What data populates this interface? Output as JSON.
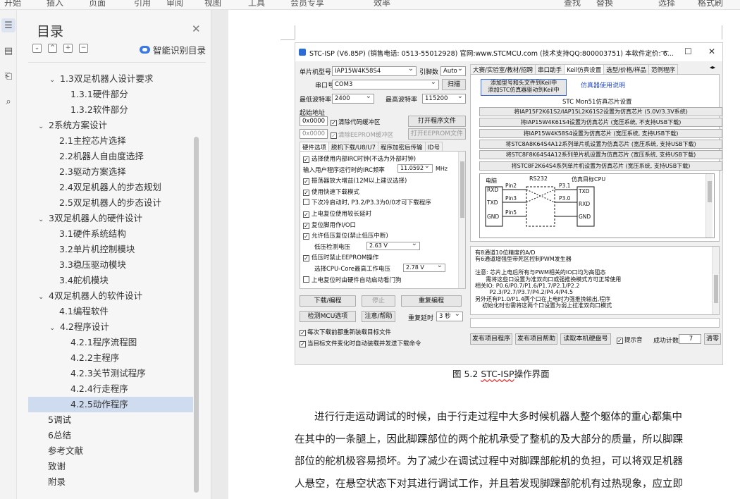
{
  "topstrip": [
    "开始",
    "插入",
    "页面",
    "引用",
    "审阅",
    "视图",
    "工具",
    "会员专享",
    "效率",
    "查找",
    "替换",
    "选择",
    "格式刷"
  ],
  "toc": {
    "title": "目录",
    "ai_label": "智能识别目录",
    "tools": [
      "⌄",
      "^",
      "+",
      "−"
    ],
    "items": [
      {
        "label": "1.3双足机器人设计要求",
        "chevron": "⌄"
      },
      {
        "label": "1.3.1硬件部分",
        "chevron": ""
      },
      {
        "label": "1.3.2软件部分",
        "chevron": ""
      },
      {
        "label": "2系统方案设计",
        "chevron": "⌄"
      },
      {
        "label": "2.1主控芯片选择",
        "chevron": ""
      },
      {
        "label": "2.2机器人自由度选择",
        "chevron": ""
      },
      {
        "label": "2.3驱动方案选择",
        "chevron": ""
      },
      {
        "label": "2.4双足机器人的步态规划",
        "chevron": ""
      },
      {
        "label": "2.5双足机器人的步态设计",
        "chevron": ""
      },
      {
        "label": "3双足机器人的硬件设计",
        "chevron": "⌄"
      },
      {
        "label": "3.1硬件系统结构",
        "chevron": ""
      },
      {
        "label": "3.2单片机控制模块",
        "chevron": ""
      },
      {
        "label": "3.3稳压驱动模块",
        "chevron": ""
      },
      {
        "label": "3.4舵机模块",
        "chevron": ""
      },
      {
        "label": "4双足机器人的软件设计",
        "chevron": "⌄"
      },
      {
        "label": "4.1编程软件",
        "chevron": ""
      },
      {
        "label": "4.2程序设计",
        "chevron": "⌄"
      },
      {
        "label": "4.2.1程序流程图",
        "chevron": ""
      },
      {
        "label": "4.2.2主程序",
        "chevron": ""
      },
      {
        "label": "4.2.3关节测试程序",
        "chevron": ""
      },
      {
        "label": "4.2.4行走程序",
        "chevron": ""
      },
      {
        "label": "4.2.5动作程序",
        "chevron": ""
      },
      {
        "label": "5调试",
        "chevron": ""
      },
      {
        "label": "6总结",
        "chevron": ""
      },
      {
        "label": "参考文献",
        "chevron": ""
      },
      {
        "label": "致谢",
        "chevron": ""
      },
      {
        "label": "附录",
        "chevron": ""
      }
    ]
  },
  "stc": {
    "title": "STC-ISP (V6.85P) (销售电话: 0513-55012928) 官网:www.STCMCU.com (技术支持QQ:800003751) 本软件定价: 6...",
    "mcu_label": "单片机型号",
    "mcu_value": "IAP15W4K58S4",
    "pins_label": "引脚数",
    "pins_value": "Auto",
    "port_label": "串口号",
    "port_value": "COM3",
    "scan": "扫描",
    "min_baud_label": "最低波特率",
    "min_baud": "2400",
    "max_baud_label": "最高波特率",
    "max_baud": "115200",
    "start_addr_label": "起始地址",
    "addr1": "0x0000",
    "clear_code": "清除代码缓冲区",
    "open_prog": "打开程序文件",
    "addr2": "0x0000",
    "clear_eeprom": "清除EEPROM缓冲区",
    "open_eeprom": "打开EEPROM文件",
    "left_tabs": [
      "硬件选项",
      "脱机下载/U8/U7",
      "程序加密后传输",
      "ID号"
    ],
    "options": [
      {
        "label": "选择使用内部IRC时钟(不选为外部时钟)",
        "checked": true
      },
      {
        "label": "输入用户程序运行时的IRC频率",
        "checked": null
      },
      {
        "label": "振荡器放大增益(12M以上建议选择)",
        "checked": true
      },
      {
        "label": "使用快速下载模式",
        "checked": true
      },
      {
        "label": "下次冷启动时, P3.2/P3.3为0/0才可下载程序",
        "checked": false
      },
      {
        "label": "上电复位使用较长延时",
        "checked": true
      },
      {
        "label": "复位脚用作I/O口",
        "checked": true
      },
      {
        "label": "允许低压复位(禁止低压中断)",
        "checked": true
      },
      {
        "label": "低压检测电压",
        "checked": null
      },
      {
        "label": "低压时禁止EEPROM操作",
        "checked": true
      },
      {
        "label": "选择CPU-Core最高工作电压",
        "checked": null
      },
      {
        "label": "上电复位时由硬件自动启动看门狗",
        "checked": false
      }
    ],
    "irc_freq": "11.0592",
    "irc_unit": "MHz",
    "low_volt": "2.63 V",
    "cpu_volt": "2.78 V",
    "btn_download": "下载/编程",
    "btn_stop": "停止",
    "btn_reprog": "重复编程",
    "btn_detect": "检测MCU选项",
    "btn_help": "注意/帮助",
    "repeat_delay_label": "重复延时",
    "repeat_delay": "3 秒",
    "chk_reload": "每次下载前都重新装载目标文件",
    "chk_autosend": "当目标文件变化时自动装载并发送下载命令",
    "right_tabs": [
      "大赛/实验室/教材/招聘",
      "串口助手",
      "Keil仿真设置",
      "选型/价格/样品",
      "范例程序"
    ],
    "keil_add": "添加型号和头文件到Keil中\n添加STC仿真器驱动到Keil中",
    "keil_help": "仿真器使用说明",
    "keil_group": "STC Mon51仿真芯片设置",
    "keil_buttons": [
      "将IAP15F2K61S2/IAP15L2K61S2设置为仿真芯片 (5.0V/3.3V系统)",
      "将IAP15W4K61S4设置为仿真芯片 (宽压系统, 不支持USB下载)",
      "将IAP15W4K58S4设置为仿真芯片 (宽压系统, 支持USB下载)",
      "将STC8A8K64S4A12系列单片机设置为仿真芯片 (宽压系统, 支持USB下载)",
      "将STC8F8K64S4A12系列单片机设置为仿真芯片 (宽压系统, 支持USB下载)",
      "将STC8F2K64S4系列单片机设置为仿真芯片 (宽压系统, 支持USB下载)"
    ],
    "diagram": {
      "pc": "电脑",
      "rs232": "RS232",
      "target": "仿真目标CPU",
      "rxd": "RXD",
      "txd": "TXD",
      "gnd": "GND",
      "pin2": "Pin2",
      "pin3": "Pin3",
      "pin5": "Pin5",
      "p31": "P3.1",
      "p30": "P3.0"
    },
    "info_lines": [
      "有8通道10位精度的A/D",
      "有6通道增强型带死区控制PWM发生器",
      "",
      "注意: 芯片上电后所有与PWM相关的IO口均为高阻态",
      "      需将这些口设置为准双向口或强推挽模式方可正常使用",
      "相关IO: P0.6/P0.7/P1.6/P1.7/P2.1/P2.2",
      "        P2.3/P2.7/P3.7/P4.2/P4.4/P4.5",
      "另外还有P1.0/P1.4两个口在上电时为强推挽输出,程序",
      "    初始化时也需将这两个口设置为弱上拉准双向口模式"
    ],
    "bottom_btns": [
      "发布项目程序",
      "发布项目帮助",
      "读取本机硬盘号"
    ],
    "chk_beep": "提示音",
    "success_label": "成功计数",
    "success_count": "7",
    "clear": "清零"
  },
  "doc": {
    "caption_prefix": "图 5.2 ",
    "caption_ul": "STC-ISP",
    "caption_suffix": "操作界面",
    "paragraph": [
      "进行行走运动调试的时候，由于行走过程中大多时候机器人整个躯体的重心都集中",
      "在其中的一条腿上，因此脚踝部位的两个舵机承受了整机的及大部分的质量，所以脚踝",
      "部位的舵机极容易损坏。为了减少在调试过程中对脚踝部舵机的负担，可以将双足机器",
      "人悬空，在悬空状态下对其进行调试工作，并且若发现脚踝部舵机有过热现象，应立即"
    ]
  }
}
